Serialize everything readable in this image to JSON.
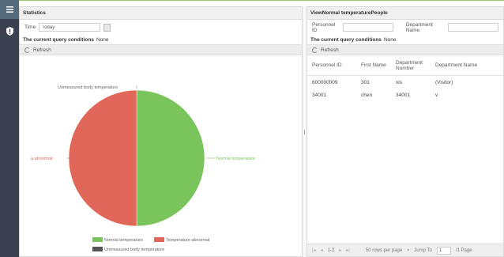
{
  "statistics": {
    "title": "Statistics",
    "time_label": "Time",
    "time_value": "Today",
    "conditions_label": "The current query conditions",
    "conditions_value": "None",
    "refresh_label": "Refresh"
  },
  "chart_data": {
    "type": "pie",
    "title": "",
    "slices": [
      {
        "name": "Normal temperature",
        "value": 50,
        "color": "#7ac45c"
      },
      {
        "name": "Temperature abnormal",
        "value": 50,
        "color": "#e0675a"
      },
      {
        "name": "Unmeasured body temperature",
        "value": 0,
        "color": "#555555"
      }
    ],
    "callouts": {
      "top": "Unmeasured body temperature",
      "left": "a abnormal",
      "right": "Normal temperature"
    },
    "legend": [
      "Normal temperature",
      "Temperature abnormal",
      "Unmeasured body temperature"
    ],
    "legend_position": "bottom"
  },
  "view_panel": {
    "title": "ViewNormal temperaturePeople",
    "personnel_id_label": "Personnel ID",
    "personnel_id_value": "",
    "department_name_label": "Department Name",
    "department_name_value": "",
    "conditions_label": "The current query conditions",
    "conditions_value": "None",
    "refresh_label": "Refresh",
    "columns": [
      "Personnel ID",
      "First Name",
      "Department Number",
      "Department Name"
    ],
    "rows": [
      [
        "600000009",
        "301",
        "vis",
        "(Visitor)"
      ],
      [
        "34001",
        "chen",
        "34001",
        "v"
      ]
    ],
    "pager": {
      "range": "1-2",
      "rows_per_page": "50 rows per page",
      "jump_label": "Jump To",
      "jump_value": "1",
      "total_pages": "/1 Page"
    }
  },
  "colors": {
    "sidebar": "#3b4150",
    "accent": "#9acb71"
  }
}
